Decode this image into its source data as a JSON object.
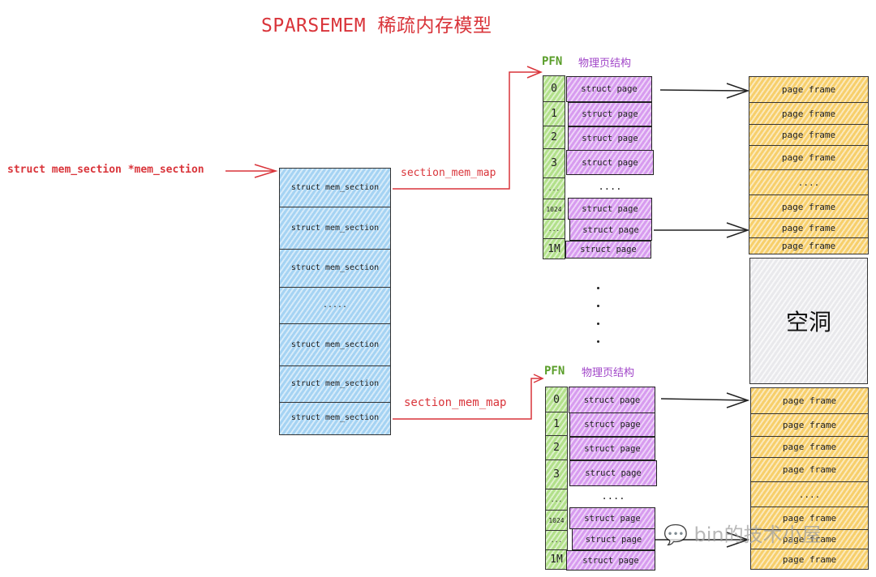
{
  "title": "SPARSEMEM 稀疏内存模型",
  "pointer_label": "struct mem_section *mem_section",
  "mem_section_array": {
    "cells": [
      "struct mem_section",
      "struct mem_section",
      "struct mem_section",
      ".....",
      "struct mem_section",
      "struct mem_section",
      "struct mem_section"
    ]
  },
  "top_group": {
    "link_label": "section_mem_map",
    "pfn_header": "PFN",
    "struct_header": "物理页结构",
    "pfns": [
      "0",
      "1",
      "2",
      "3",
      "...",
      "1024",
      "...",
      "1M"
    ],
    "struct_pages": [
      "struct page",
      "struct page",
      "struct page",
      "struct page",
      "....",
      "struct page",
      "struct page",
      "struct page"
    ]
  },
  "bottom_group": {
    "link_label": "section_mem_map",
    "pfn_header": "PFN",
    "struct_header": "物理页结构",
    "pfns": [
      "0",
      "1",
      "2",
      "3",
      "...",
      "1024",
      "...",
      "1M"
    ],
    "struct_pages": [
      "struct page",
      "struct page",
      "struct page",
      "struct page",
      "....",
      "struct page",
      "struct page",
      "struct page"
    ]
  },
  "top_frames": [
    "page frame",
    "page frame",
    "page frame",
    "page frame",
    "....",
    "page frame",
    "page frame",
    "page frame"
  ],
  "hole_label": "空洞",
  "bottom_frames": [
    "page frame",
    "page frame",
    "page frame",
    "page frame",
    "....",
    "page frame",
    "page frame",
    "page frame"
  ],
  "watermark": "bin的技术小屋",
  "colors": {
    "title_red": "#d9343a",
    "mem_section_blue": "#a5d3f3",
    "pfn_green": "#b2e08a",
    "struct_page_purple": "#d79bef",
    "page_frame_orange": "#f7cf6b",
    "hole_gray": "#e9e9ec"
  }
}
